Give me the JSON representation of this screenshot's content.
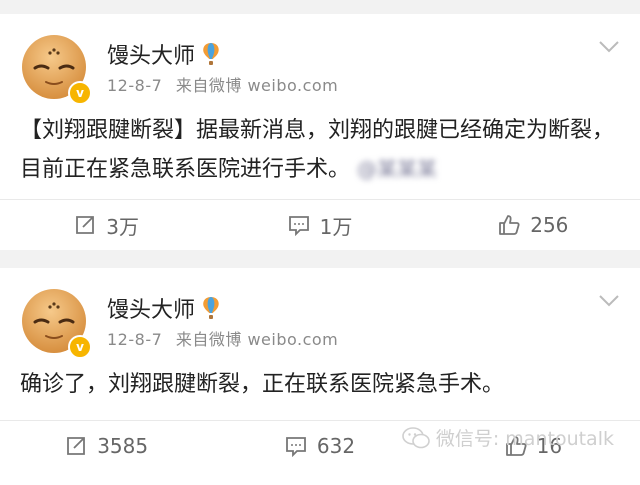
{
  "posts": [
    {
      "username": "馒头大师",
      "date": "12-8-7",
      "source": "来自微博 weibo.com",
      "badge": "v",
      "content": "【刘翔跟腱断裂】据最新消息，刘翔的跟腱已经确定为断裂，目前正在紧急联系医院进行手术。",
      "blurred_tag": "@某某某",
      "repost_count": "3万",
      "comment_count": "1万",
      "like_count": "256"
    },
    {
      "username": "馒头大师",
      "date": "12-8-7",
      "source": "来自微博 weibo.com",
      "badge": "v",
      "content": "确诊了，刘翔跟腱断裂，正在联系医院紧急手术。",
      "repost_count": "3585",
      "comment_count": "632",
      "like_count": "16"
    }
  ],
  "watermark": {
    "text": "微信号: mantoutalk"
  },
  "icons": {
    "avatar": "bald-cartoon-avatar",
    "verified": "verified-badge-icon",
    "balloon": "hot-air-balloon-icon",
    "chevron": "chevron-down-icon",
    "repost": "repost-icon",
    "comment": "comment-icon",
    "like": "thumbs-up-icon",
    "wechat": "wechat-icon"
  },
  "colors": {
    "background": "#f2f2f2",
    "card": "#ffffff",
    "badge": "#f7b500",
    "meta_text": "#8a8a8a"
  }
}
